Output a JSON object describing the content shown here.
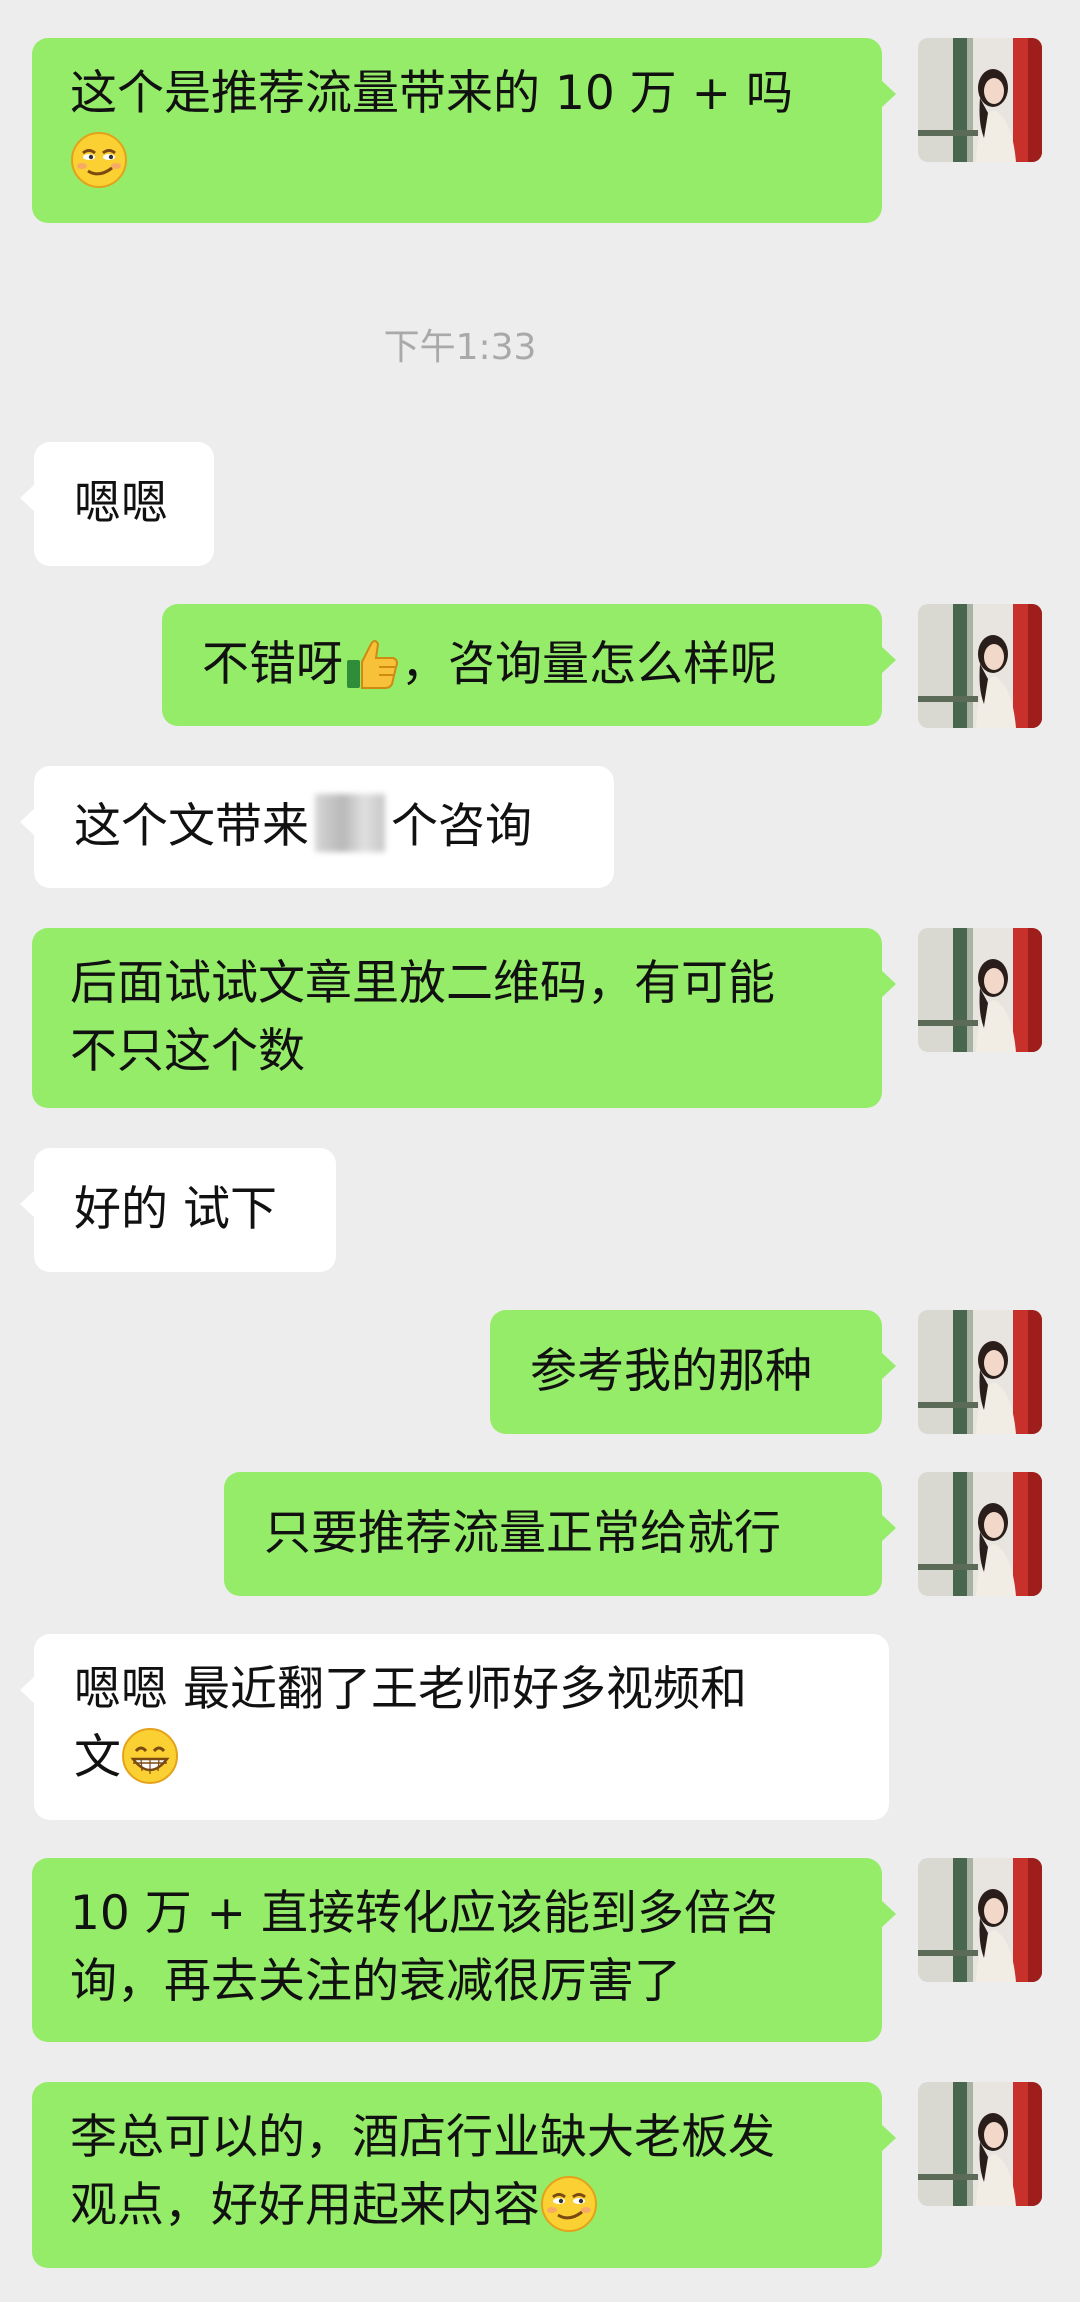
{
  "messages": [
    {
      "id": "m1",
      "side": "right",
      "text": "这个是推荐流量带来的 10 万 + 吗",
      "emoji": "smirk-emoji-icon"
    },
    {
      "id": "time1",
      "type": "timestamp",
      "text": "下午1:33"
    },
    {
      "id": "m2",
      "side": "left",
      "text": "嗯嗯"
    },
    {
      "id": "m3",
      "side": "right",
      "text_before": "不错呀",
      "text_after": "，咨询量怎么样呢",
      "emoji": "thumbs-up-emoji-icon"
    },
    {
      "id": "m4",
      "side": "left",
      "text_before": "这个文带来",
      "text_after": "个咨询",
      "redacted": true
    },
    {
      "id": "m5",
      "side": "right",
      "lines": [
        "后面试试文章里放二维码，有可能",
        "不只这个数"
      ]
    },
    {
      "id": "m6",
      "side": "left",
      "text": "好的 试下"
    },
    {
      "id": "m7",
      "side": "right",
      "text": "参考我的那种"
    },
    {
      "id": "m8",
      "side": "right",
      "text": "只要推荐流量正常给就行"
    },
    {
      "id": "m9",
      "side": "left",
      "lines": [
        "嗯嗯 最近翻了王老师好多视频和",
        "文"
      ],
      "emoji": "grin-emoji-icon"
    },
    {
      "id": "m10",
      "side": "right",
      "lines": [
        "10 万 + 直接转化应该能到多倍咨",
        "询，再去关注的衰减很厉害了"
      ]
    },
    {
      "id": "m11",
      "side": "right",
      "lines": [
        "李总可以的，酒店行业缺大老板发",
        "观点，好好用起来内容"
      ],
      "emoji": "smirk-emoji-icon"
    }
  ],
  "colors": {
    "background": "#ededed",
    "bubble_right": "#95ec69",
    "bubble_left": "#ffffff",
    "timestamp": "#a9a9a9"
  }
}
